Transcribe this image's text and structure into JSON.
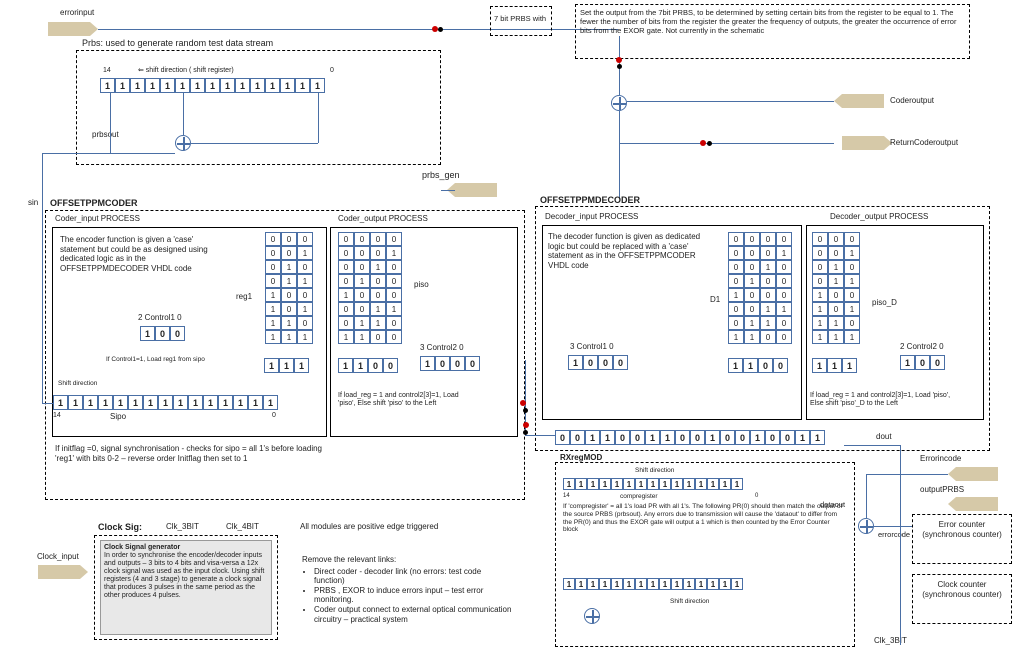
{
  "labels": {
    "errorinput": "errorinput",
    "prbs": "Prbs:    used to generate  random test data stream",
    "prbsout": "prbsout",
    "prbs_gen": "prbs_gen",
    "sin": "sin",
    "offsetppmcoder": "OFFSETPPMCODER",
    "coder_input_proc": "Coder_input PROCESS",
    "coder_output_proc": "Coder_output PROCESS",
    "encnote": "The encoder function is given a 'case' statement but could be as designed using dedicated logic as in the OFFSETPPMDECODER VHDL code",
    "reg1": "reg1",
    "piso": "piso",
    "control1": "2  Control1  0",
    "control2": "3  Control2   0",
    "control1b": "3  Control1  0",
    "control2b": "2  Control2  0",
    "ifcontrol1": "If Control1=1,   Load reg1 from sipo",
    "shiftdir": "Shift direction",
    "ifload": "If load_reg = 1 and control2[3]=1, Load 'piso', Else shift 'piso' to the Left",
    "ifload2": "If load_reg = 1 and control2[3]=1, Load 'piso', Else shift 'piso'_D to the Left",
    "sipo": "Sipo",
    "initflag": "If initflag =0, signal synchronisation  - checks for sipo = all 1's before loading 'reg1' with bits 0-2 – reverse order Initflag then set to 1",
    "clocksig": "Clock Sig:",
    "clk3": "Clk_3BIT",
    "clk4": "Clk_4BIT",
    "clockinput": "Clock_input",
    "allmods": "All modules  are positive edge triggered",
    "remove": "Remove the relevant links:",
    "rem1": "Direct coder  - decoder link (no errors: test code function)",
    "rem2": "PRBS , EXOR to induce errors input – test error monitoring.",
    "rem3": "Coder output connect to external optical communication circuitry – practical system",
    "clockgen_title": "Clock Signal generator",
    "clockgen": "In order to synchronise the encoder/decoder inputs and outputs – 3 bits to 4 bits and visa-versa a 12x clock signal was used as the input clock. Using shift registers (4 and 3 stage) to generate a clock signal that produces 3 pulses in the same period as the other produces 4 pulses.",
    "sevenprbs": "7 bit PRBS with",
    "sevenprbs_note": "Set the output from the 7bit PRBS, to be determined by setting certain bits from the register to be equal to 1. The fewer the number of bits from the register the greater the frequency of outputs, the greater the occurrence of error bits from the EXOR gate. Not currently in the schematic",
    "coderoutput": "Coderoutput",
    "returncoder": "ReturnCoderoutput",
    "offsetdecoder": "OFFSETPPMDECODER",
    "dec_input_proc": "Decoder_input PROCESS",
    "dec_output_proc": "Decoder_output PROCESS",
    "decnote": "The decoder function is given as dedicated logic but could be replaced with a 'case' statement as in the OFFSETPPMCODER VHDL code",
    "D1": "D1",
    "piso_D": "piso_D",
    "dout": "dout",
    "rxregmod": "RXregMOD",
    "compregister": "compregister",
    "compnote": "If 'compregister' = all 1's load PR with all 1's. The following PR(0) should then match the output of the source PRBS (prbsout). Any errors due to transmission will cause the 'dataout' to differ from the PR(0) and thus the EXOR gate will output a 1 which is then counted by the Error Counter block",
    "dataout": "dataout",
    "errorcode": "errorcode",
    "errorincode": "Errorincode",
    "outputprbs": "outputPRBS",
    "errcounter": "Error counter (synchronous counter)",
    "clkcounter": "Clock counter (synchronous counter)",
    "num14": "14",
    "num0": "0",
    "shiftdir_reg": "⇐ shift direction ( shift register)"
  },
  "prbs_bits": [
    "1",
    "1",
    "1",
    "1",
    "1",
    "1",
    "1",
    "1",
    "1",
    "1",
    "1",
    "1",
    "1",
    "1",
    "1"
  ],
  "sipo_bits": [
    "1",
    "1",
    "1",
    "1",
    "1",
    "1",
    "1",
    "1",
    "1",
    "1",
    "1",
    "1",
    "1",
    "1",
    "1"
  ],
  "decoder_sipo": [
    "0",
    "0",
    "1",
    "1",
    "0",
    "0",
    "1",
    "1",
    "0",
    "0",
    "1",
    "0",
    "0",
    "1",
    "0",
    "0",
    "1",
    "1"
  ],
  "compreg": [
    "1",
    "1",
    "1",
    "1",
    "1",
    "1",
    "1",
    "1",
    "1",
    "1",
    "1",
    "1",
    "1",
    "1",
    "1"
  ],
  "bottomreg": [
    "1",
    "1",
    "1",
    "1",
    "1",
    "1",
    "1",
    "1",
    "1",
    "1",
    "1",
    "1",
    "1",
    "1",
    "1"
  ],
  "ctrl1": [
    "1",
    "0",
    "0"
  ],
  "ctrl2": [
    "1",
    "0",
    "0",
    "0"
  ],
  "ctrl1b": [
    "1",
    "0",
    "0",
    "0"
  ],
  "ctrl2b": [
    "1",
    "0",
    "0"
  ],
  "reg1row": [
    "1",
    "1",
    "1"
  ],
  "pisorow": [
    "1",
    "1",
    "0",
    "0"
  ],
  "d1row": [
    "1",
    "1",
    "0",
    "0"
  ],
  "pisoD_row": [
    "1",
    "1",
    "1"
  ],
  "grid_reg1": [
    [
      "0",
      "0",
      "0"
    ],
    [
      "0",
      "0",
      "1"
    ],
    [
      "0",
      "1",
      "0"
    ],
    [
      "0",
      "1",
      "1"
    ],
    [
      "1",
      "0",
      "0"
    ],
    [
      "1",
      "0",
      "1"
    ],
    [
      "1",
      "1",
      "0"
    ],
    [
      "1",
      "1",
      "1"
    ]
  ],
  "grid_piso": [
    [
      "0",
      "0",
      "0",
      "0"
    ],
    [
      "0",
      "0",
      "0",
      "1"
    ],
    [
      "0",
      "0",
      "1",
      "0"
    ],
    [
      "0",
      "1",
      "0",
      "0"
    ],
    [
      "1",
      "0",
      "0",
      "0"
    ],
    [
      "0",
      "0",
      "1",
      "1"
    ],
    [
      "0",
      "1",
      "1",
      "0"
    ],
    [
      "1",
      "1",
      "0",
      "0"
    ]
  ],
  "grid_D1": [
    [
      "0",
      "0",
      "0",
      "0"
    ],
    [
      "0",
      "0",
      "0",
      "1"
    ],
    [
      "0",
      "0",
      "1",
      "0"
    ],
    [
      "0",
      "1",
      "0",
      "0"
    ],
    [
      "1",
      "0",
      "0",
      "0"
    ],
    [
      "0",
      "0",
      "1",
      "1"
    ],
    [
      "0",
      "1",
      "1",
      "0"
    ],
    [
      "1",
      "1",
      "0",
      "0"
    ]
  ],
  "grid_pisoD": [
    [
      "0",
      "0",
      "0"
    ],
    [
      "0",
      "0",
      "1"
    ],
    [
      "0",
      "1",
      "0"
    ],
    [
      "0",
      "1",
      "1"
    ],
    [
      "1",
      "0",
      "0"
    ],
    [
      "1",
      "0",
      "1"
    ],
    [
      "1",
      "1",
      "0"
    ],
    [
      "1",
      "1",
      "1"
    ]
  ]
}
